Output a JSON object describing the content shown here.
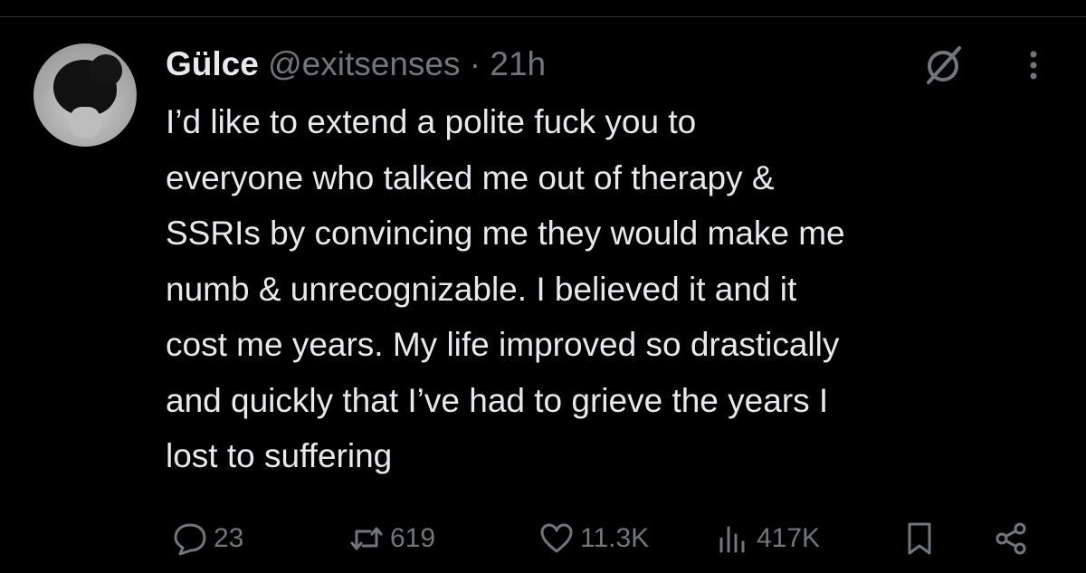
{
  "tweet": {
    "author_name": "Gülce",
    "handle": "@exitsenses",
    "separator": "·",
    "time": "21h",
    "text": "I’d like to extend a polite fuck you to\neveryone who talked me out of therapy &\nSSRIs by convincing me they would make me\nnumb & unrecognizable. I believed it and it\ncost me years. My life improved so drastically\nand quickly that I’ve had to grieve the years I\nlost to suffering"
  },
  "actions": {
    "replies": "23",
    "reposts": "619",
    "likes": "11.3K",
    "views": "417K"
  },
  "icons": {
    "header": [
      "grok-icon",
      "more-icon"
    ],
    "action_bar": [
      "reply-icon",
      "repost-icon",
      "like-icon",
      "views-icon",
      "bookmark-icon",
      "share-icon"
    ]
  },
  "colors": {
    "background": "#000000",
    "text": "#e7e9ea",
    "secondary": "#71767b"
  }
}
